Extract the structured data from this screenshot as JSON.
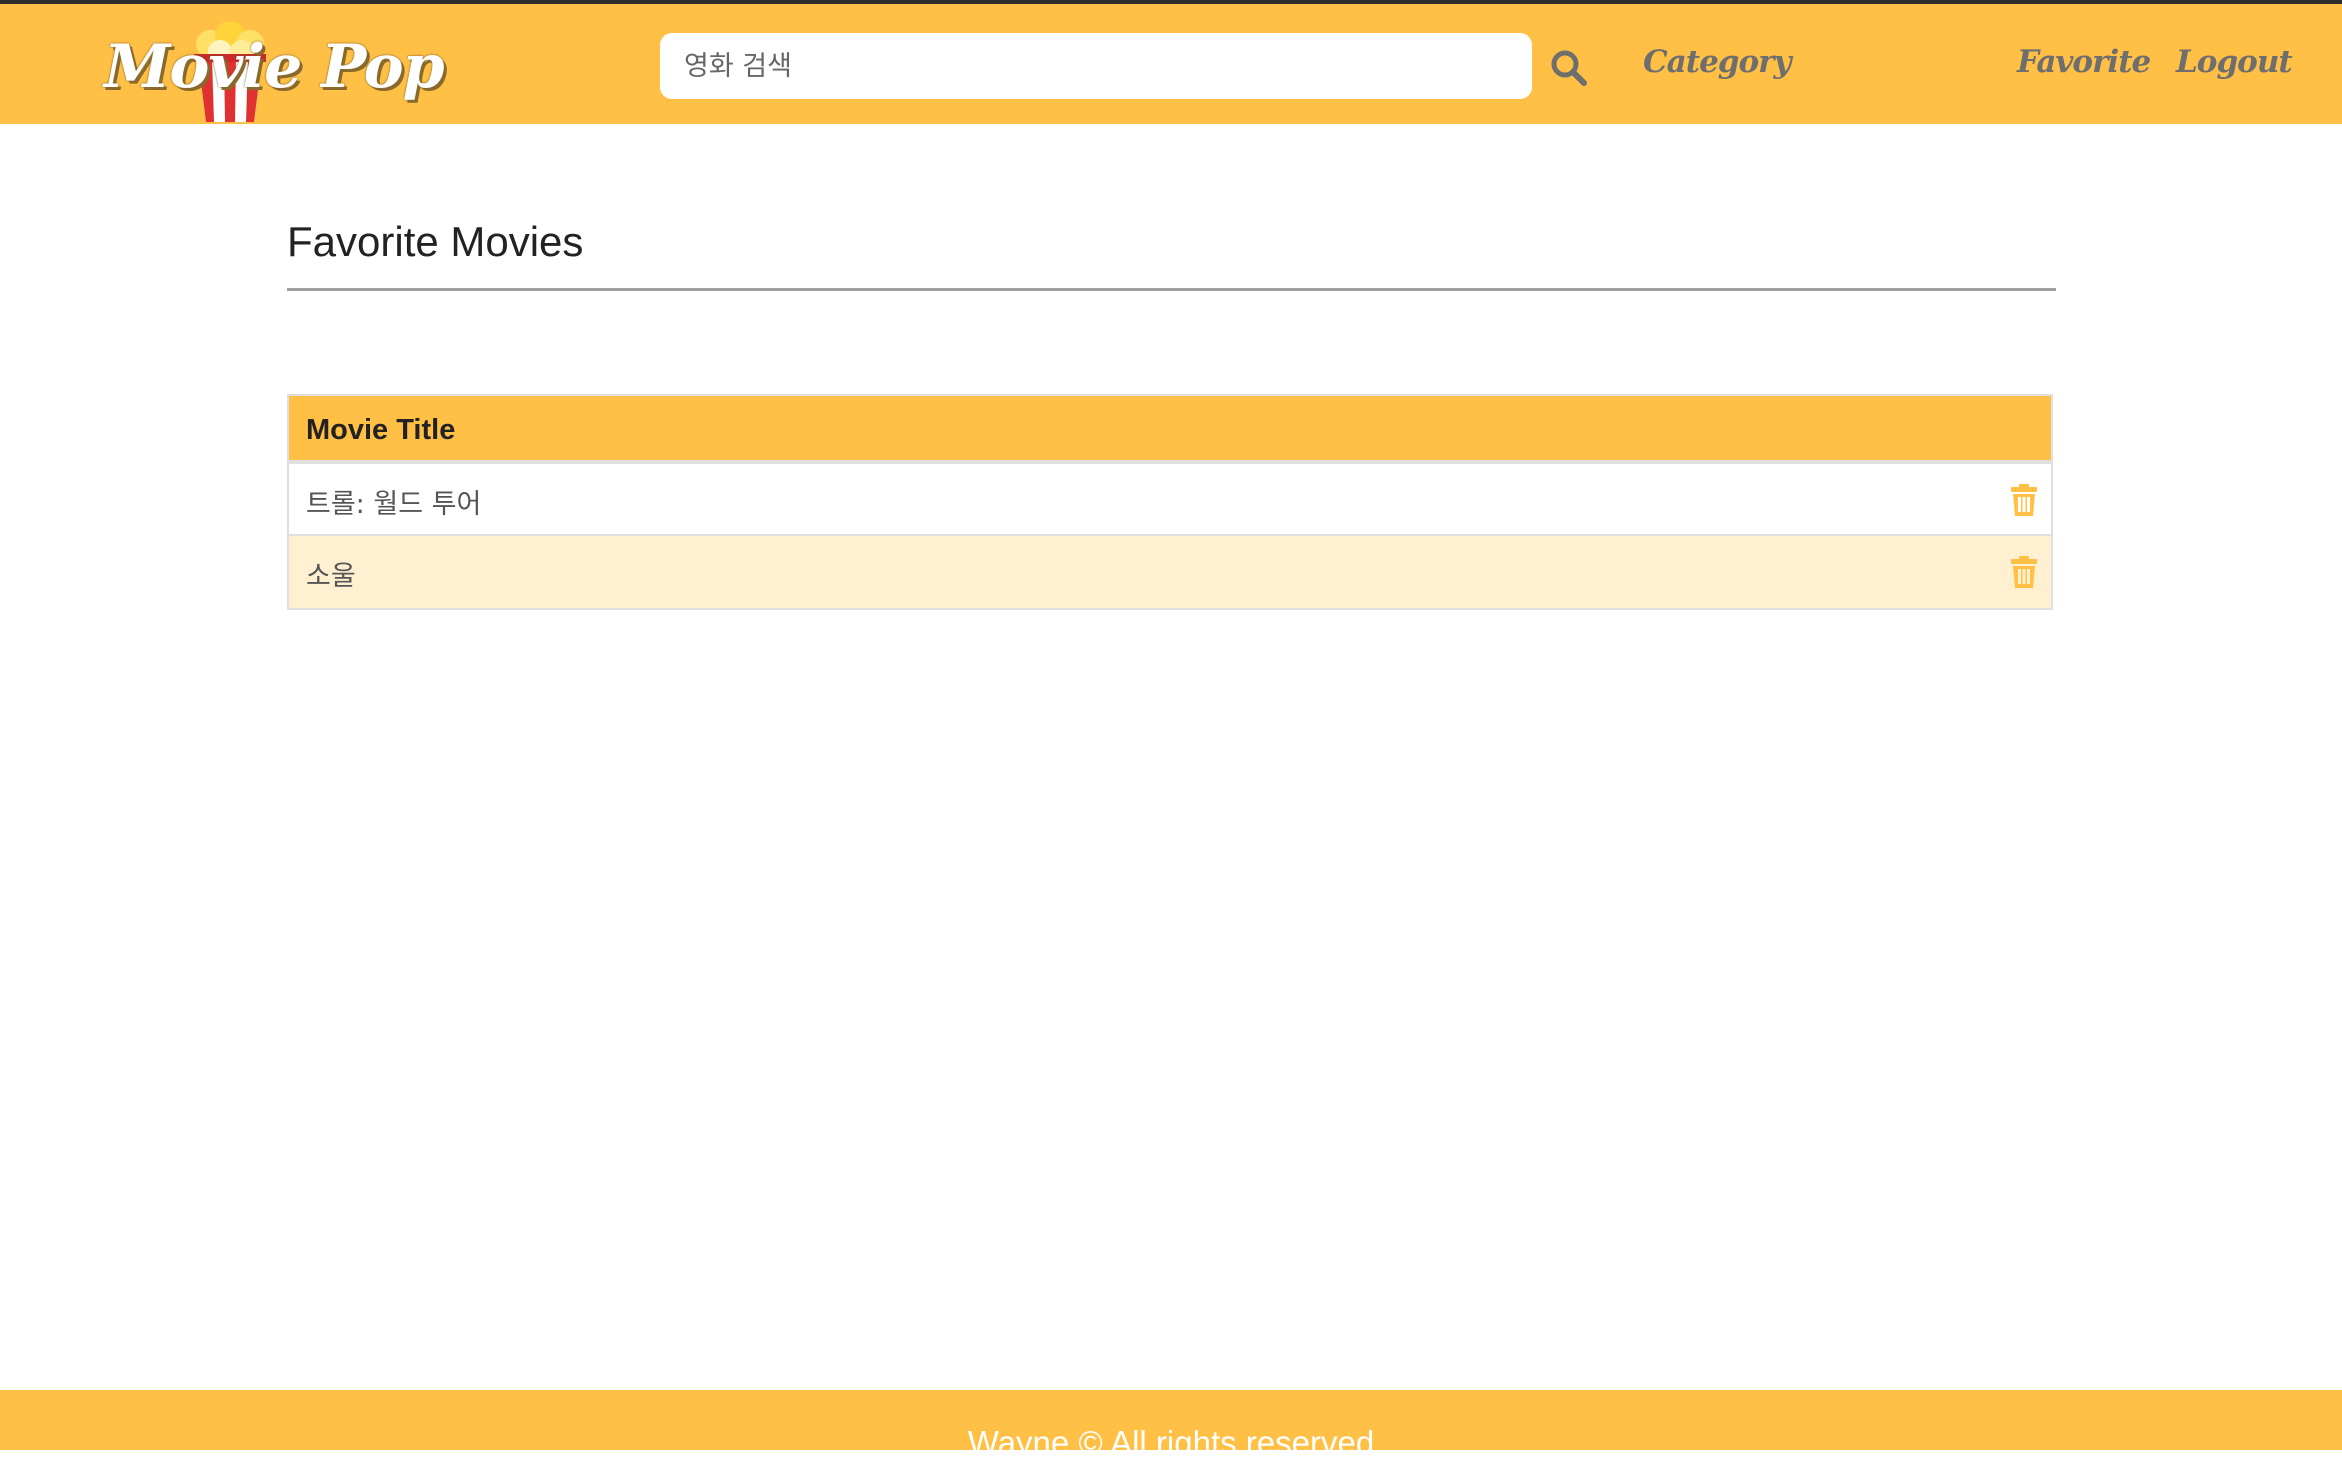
{
  "header": {
    "logo_text": "Movie Pop",
    "search": {
      "placeholder": "영화 검색",
      "value": ""
    },
    "nav": {
      "category": "Category",
      "favorite": "Favorite",
      "logout": "Logout"
    },
    "icons": {
      "search": "search-icon",
      "logo": "popcorn-icon"
    }
  },
  "main": {
    "title": "Favorite Movies",
    "table": {
      "header": "Movie Title",
      "rows": [
        {
          "title": "트롤: 월드 투어"
        },
        {
          "title": "소울"
        }
      ],
      "row_action_icon": "trash-icon"
    }
  },
  "footer": {
    "text": "Wayne © All rights reserved"
  },
  "colors": {
    "brand": "#ffc045",
    "alt_row": "#fff0d2",
    "nav_text": "#6e6e6e",
    "top_line": "#2e2e2e"
  }
}
